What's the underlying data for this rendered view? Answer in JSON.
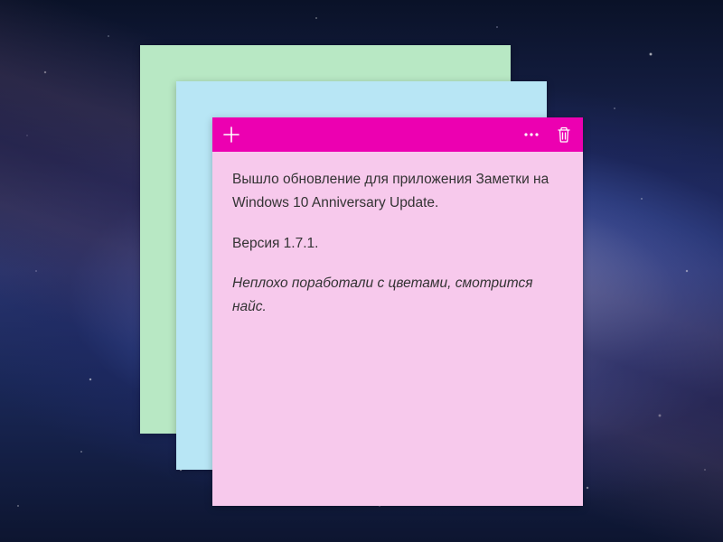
{
  "notes": {
    "green": {
      "color": "#b8e8c4"
    },
    "blue": {
      "color": "#b8e6f5"
    },
    "pink": {
      "color": "#f7c9ec",
      "accent": "#ec00b1",
      "content": {
        "line1": "Вышло обновление для приложения Заметки на Windows 10 Anniversary Update.",
        "line2": "Версия 1.7.1.",
        "line3": "Неплохо поработали с цветами, смотрится найс."
      }
    }
  }
}
